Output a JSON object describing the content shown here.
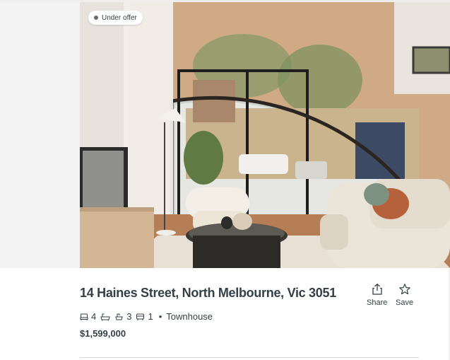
{
  "listing": {
    "status_badge": "Under offer",
    "status_color": "#6b6b6b",
    "address": "14 Haines Street, North Melbourne, Vic 3051",
    "bedrooms": "4",
    "bathrooms": "3",
    "parking": "1",
    "separator": "•",
    "property_type": "Townhouse",
    "price": "$1,599,000"
  },
  "actions": {
    "share_label": "Share",
    "save_label": "Save"
  },
  "icons": {
    "bed": "bed-icon",
    "bath": "bath-icon",
    "car": "car-icon",
    "share": "share-icon",
    "save": "star-icon"
  }
}
